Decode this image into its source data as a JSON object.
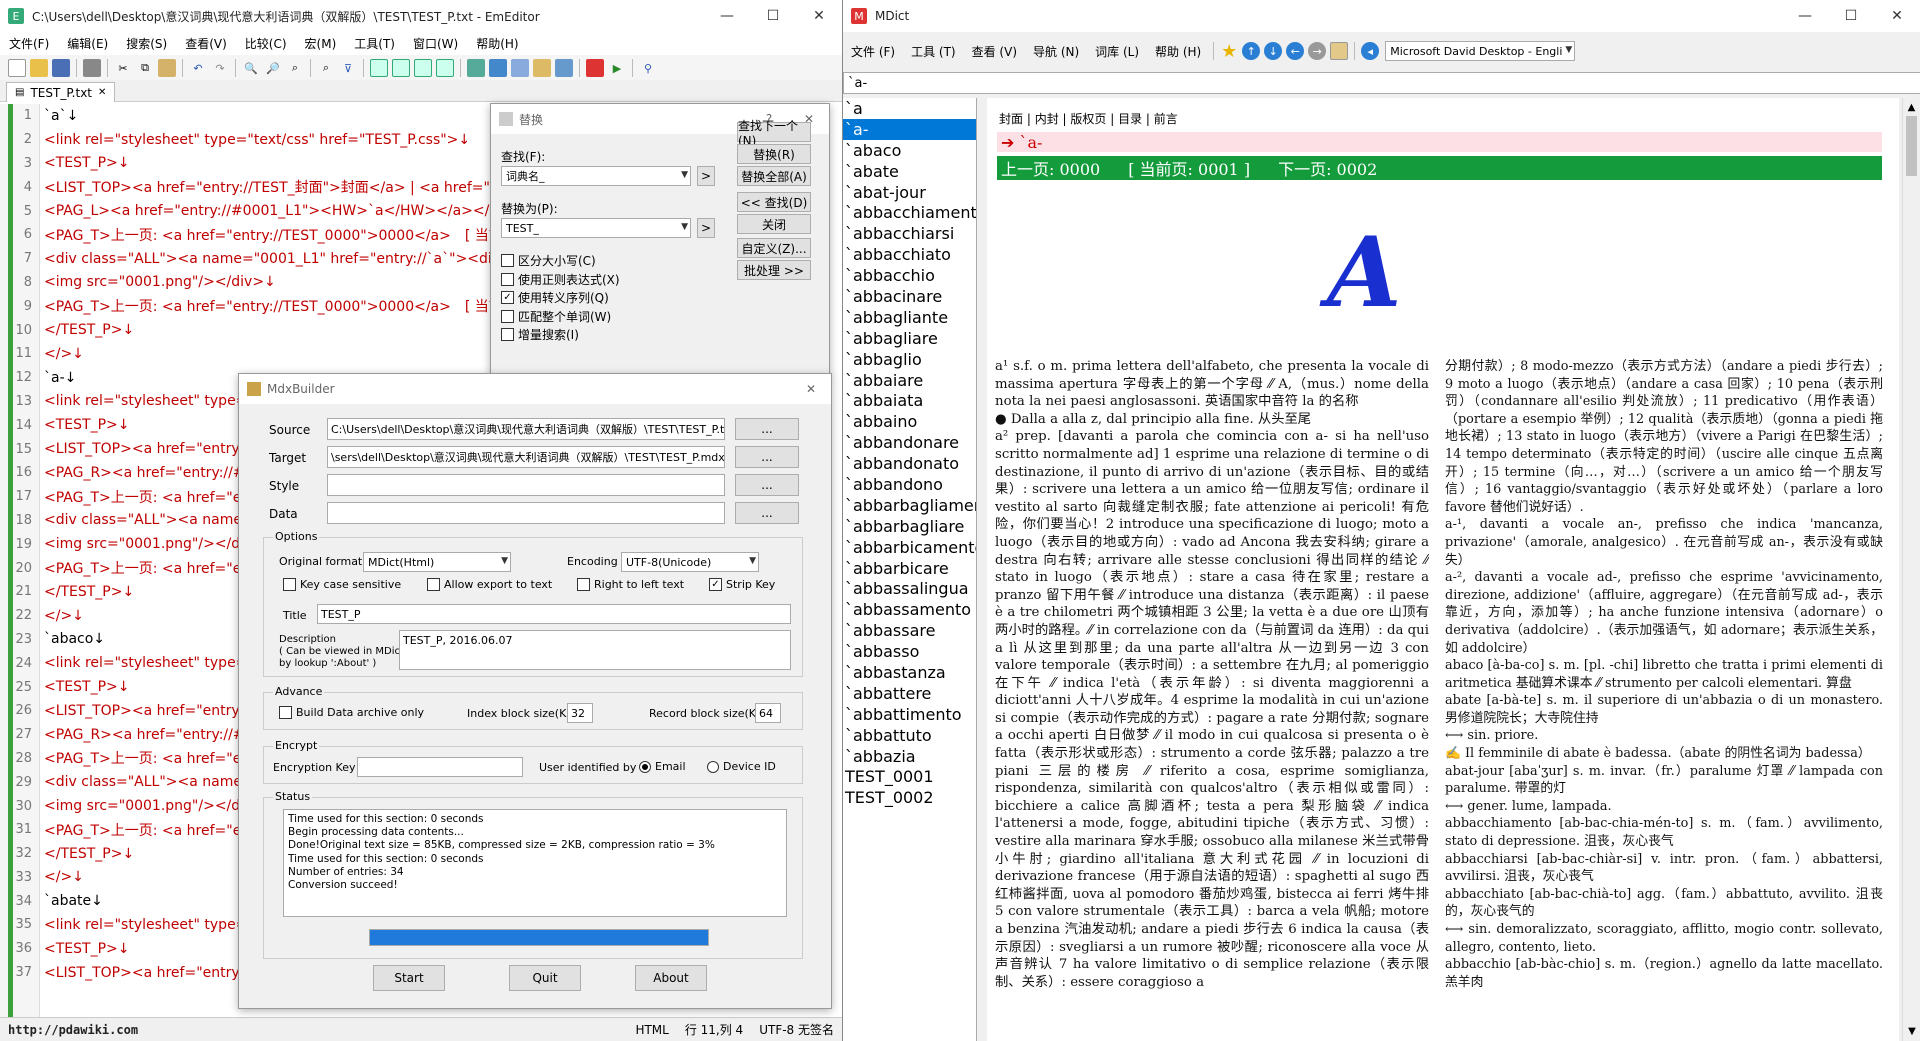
{
  "emeditor": {
    "title": "C:\\Users\\dell\\Desktop\\意汉词典\\现代意大利语词典（双解版）\\TEST\\TEST_P.txt - EmEditor",
    "menu": [
      "文件(F)",
      "编辑(E)",
      "搜索(S)",
      "查看(V)",
      "比较(C)",
      "宏(M)",
      "工具(T)",
      "窗口(W)",
      "帮助(H)"
    ],
    "tab": "TEST_P.txt",
    "lines": [
      "`a`↓",
      "<link rel=\"stylesheet\" type=\"text/css\" href=\"TEST_P.css\">↓",
      "<TEST_P>↓",
      "<LIST_TOP><a href=\"entry://TEST_封面\">封面</a> | <a href=\"entry",
      "<PAG_L><a href=\"entry://#0001_L1\"><HW>`a</HW></a></PAG_",
      "<PAG_T>上一页: <a href=\"entry://TEST_0000\">0000</a>　[ 当前页",
      "<div class=\"ALL\"><a name=\"0001_L1\" href=\"entry://`a`\"><div class",
      "<img src=\"0001.png\"/></div>↓",
      "<PAG_T>上一页: <a href=\"entry://TEST_0000\">0000</a>　[ 当前页",
      "</TEST_P>↓",
      "</>↓",
      "`a-↓",
      "<link rel=\"stylesheet\" type=\"t",
      "<TEST_P>↓",
      "<LIST_TOP><a href=\"entry://",
      "<PAG_R><a href=\"entry://#0",
      "<PAG_T>上一页: <a href=\"ent",
      "<div class=\"ALL\"><a name=\"",
      "<img src=\"0001.png\"/></div",
      "<PAG_T>上一页: <a href=\"ent",
      "</TEST_P>↓",
      "</>↓",
      "`abaco↓",
      "<link rel=\"stylesheet\" type=\"t",
      "<TEST_P>↓",
      "<LIST_TOP><a href=\"entry://",
      "<PAG_R><a href=\"entry://#0",
      "<PAG_T>上一页: <a href=\"ent",
      "<div class=\"ALL\"><a name=\"",
      "<img src=\"0001.png\"/></div",
      "<PAG_T>上一页: <a href=\"ent",
      "</TEST_P>↓",
      "</>↓",
      "`abate↓",
      "<link rel=\"stylesheet\" type=\"t",
      "<TEST_P>↓",
      "<LIST_TOP><a href=\"entry://"
    ],
    "status": {
      "watermark": "http://pdawiki.com",
      "mode": "HTML",
      "pos": "行 11,列 4",
      "enc": "UTF-8 无签名"
    }
  },
  "replace": {
    "title": "替换",
    "find_label": "查找(F):",
    "find_value": "词典名_",
    "replace_label": "替换为(P):",
    "replace_value": "TEST_",
    "checks": [
      {
        "label": "区分大小写(C)",
        "checked": false
      },
      {
        "label": "使用正则表达式(X)",
        "checked": false
      },
      {
        "label": "使用转义序列(Q)",
        "checked": true
      },
      {
        "label": "匹配整个单词(W)",
        "checked": false
      },
      {
        "label": "增量搜索(I)",
        "checked": false
      }
    ],
    "buttons": [
      "查找下一个(N)",
      "替换(R)",
      "替换全部(A)",
      "<< 查找(D)",
      "关闭",
      "自定义(Z)...",
      "批处理 >>"
    ]
  },
  "mdx": {
    "title": "MdxBuilder",
    "source_label": "Source",
    "source": "C:\\Users\\dell\\Desktop\\意汉词典\\现代意大利语词典（双解版）\\TEST\\TEST_P.t",
    "target_label": "Target",
    "target": "\\sers\\dell\\Desktop\\意汉词典\\现代意大利语词典（双解版）\\TEST\\TEST_P.mdx",
    "style_label": "Style",
    "data_label": "Data",
    "browse": "...",
    "options_title": "Options",
    "format_label": "Original format",
    "format": "MDict(Html)",
    "encoding_label": "Encoding",
    "encoding": "UTF-8(Unicode)",
    "key_case": "Key case sensitive",
    "allow_export": "Allow export to text",
    "rtl": "Right to left text",
    "strip_key": "Strip Key",
    "title_label": "Title",
    "title_value": "TEST_P",
    "desc_label": "Description",
    "desc_hint1": "( Can be viewed in MDict",
    "desc_hint2": "by lookup ':About' )",
    "desc_value": "TEST_P, 2016.06.07",
    "advance_title": "Advance",
    "build_data": "Build Data archive only",
    "index_label": "Index block size(K)",
    "index_value": "32",
    "record_label": "Record block size(K)",
    "record_value": "64",
    "encrypt_title": "Encrypt",
    "key_label": "Encryption Key",
    "user_label": "User identified by",
    "email": "Email",
    "device": "Device ID",
    "status_title": "Status",
    "log": [
      "Time used for this section: 0 seconds",
      "Begin processing data contents...",
      "Done!Original text size = 85KB, compressed size = 2KB, compression ratio = 3%",
      "Time used for this section: 0 seconds",
      "Number of entries: 34",
      "Conversion succeed!"
    ],
    "progress": 1.0,
    "start": "Start",
    "quit": "Quit",
    "about": "About"
  },
  "mdict": {
    "title": "MDict",
    "menu": [
      "文件 (F)",
      "工具 (T)",
      "查看 (V)",
      "导航 (N)",
      "词库 (L)",
      "帮助 (H)"
    ],
    "dict_select": "Microsoft David Desktop - Engli",
    "address": "`a-",
    "words": [
      "`a",
      "`a-",
      "`abaco",
      "`abate",
      "`abat-jour",
      "`abbacchiamento",
      "`abbacchiarsi",
      "`abbacchiato",
      "`abbacchio",
      "`abbacinare",
      "`abbagliante",
      "`abbagliare",
      "`abbaglio",
      "`abbaiare",
      "`abbaiata",
      "`abbaino",
      "`abbandonare",
      "`abbandonato",
      "`abbandono",
      "`abbarbagliamen",
      "`abbarbagliare",
      "`abbarbicamento",
      "`abbarbicare",
      "`abbassalingua",
      "`abbassamento",
      "`abbassare",
      "`abbasso",
      "`abbastanza",
      "`abbattere",
      "`abbattimento",
      "`abbattuto",
      "`abbazia",
      "TEST_0001",
      "TEST_0002"
    ],
    "selected_word": 1,
    "nav": [
      "封面",
      "内封",
      "版权页",
      "目录",
      "前言"
    ],
    "headword": "➔ `a-",
    "page_prev": "上一页: 0000",
    "page_cur": "[ 当前页: 0001 ]",
    "page_next": "下一页: 0002",
    "big_letter": "A",
    "col1": "a¹ s.f. o m. prima lettera dell'alfabeto, che presenta la vocale di massima apertura 字母表上的第一个字母 ⁄⁄ A,（mus.）nome della nota la nei paesi anglosassoni. 英语国家中音符 la 的名称\n● Dalla a alla z, dal principio alla fine. 从头至尾\na² prep. [davanti a parola che comincia con a- si ha nell'uso scritto normalmente ad] 1 esprime una relazione di termine o di destinazione, il punto di arrivo di un'azione（表示目标、目的或结果）: scrivere una lettera a un amico 给一位朋友写信; ordinare il vestito al sarto 向裁缝定制衣服; fate attenzione ai pericoli! 有危险，你们要当心！2 introduce una specificazione di luogo; moto a luogo（表示目的地或方向）: vado ad Ancona 我去安科纳; girare a destra 向右转; arrivare alle stesse conclusioni 得出同样的结论 ⁄⁄ stato in luogo（表示地点）: stare a casa 待在家里; restare a pranzo 留下用午餐 ⁄⁄ introduce una distanza（表示距离）: il paese è a tre chilometri 两个城镇相距 3 公里; la vetta è a due ore 山顶有两小时的路程。⁄⁄ in correlazione con da（与前置词 da 连用）: da qui a lì 从这里到那里; da una parte all'altra 从一边到另一边 3 con valore temporale（表示时间）: a settembre 在九月; al pomeriggio 在下午 ⁄⁄ indica l'età（表示年龄）: si diventa maggiorenni a diciott'anni 人十八岁成年。4 esprime la modalità in cui un'azione si compie（表示动作完成的方式）: pagare a rate 分期付款; sognare a occhi aperti 白日做梦 ⁄⁄ il modo in cui qualcosa si presenta o è fatta（表示形状或形态）: strumento a corde 弦乐器; palazzo a tre piani 三层的楼房 ⁄⁄ riferito a cosa, esprime somiglianza, rispondenza, similarità con qualcos'altro（表示相似或雷同）: bicchiere a calice 高脚酒杯; testa a pera 梨形脑袋 ⁄⁄ indica l'attenersi a mode, fogge, abitudini tipiche（表示方式、习惯）: vestire alla marinara 穿水手服; ossobuco alla milanese 米兰式带骨小牛肘; giardino all'italiana 意大利式花园 ⁄⁄ in locuzioni di derivazione francese（用于源自法语的短语）: spaghetti al sugo 西红柿酱拌面, uova al pomodoro 番茄炒鸡蛋, bistecca ai ferri 烤牛排 5 con valore strumentale（表示工具）: barca a vela 帆船; motore a benzina 汽油发动机; andare a piedi 步行去 6 indica la causa（表示原因）: svegliarsi a un rumore 被吵醒; riconoscere alla voce 从声音辨认 7 ha valore limitativo o di semplice relazione（表示限制、关系）: essere coraggioso a",
    "col2": "分期付款）; 8 modo-mezzo（表示方式方法）（andare a piedi 步行去）; 9 moto a luogo（表示地点）（andare a casa 回家）; 10 pena（表示刑罚）（condannare all'esilio 判处流放）; 11 predicativo（用作表语）（portare a esempio 举例）; 12 qualità（表示质地）（gonna a piedi 拖地长裙）; 13 stato in luogo（表示地方）（vivere a Parigi 在巴黎生活）; 14 tempo determinato（表示特定的时间）（uscire alle cinque 五点离开）; 15 termine（向…，对…）（scrivere a un amico 给一个朋友写信）; 16 vantaggio/svantaggio（表示好处或坏处）（parlare a loro favore 替他们说好话）.\na-¹, davanti a vocale an-, prefisso che indica 'mancanza, privazione'（amorale, analgesico）. 在元音前写成 an-，表示没有或缺失）\na-², davanti a vocale ad-, prefisso che esprime 'avvicinamento, direzione, addizione'（affluire, aggregare）（在元音前写成 ad-，表示靠近，方向，添加等）; ha anche funzione intensiva（adornare）o derivativa（addolcire）.（表示加强语气，如 adornare；表示派生关系，如 addolcire）\nabaco [à-ba-co] s. m. [pl. -chi] libretto che tratta i primi elementi di aritmetica 基础算术课本 ⁄⁄ strumento per calcoli elementari. 算盘\nabate [a-bà-te] s. m. il superiore di un'abbazia o di un monastero. 男修道院院长；大寺院住持\n⟷ sin. priore.\n✍ Il femminile di abate è badessa.（abate 的阴性名词为 badessa）\nabat-jour [abaˈʒur] s. m. invar.（fr.）paralume 灯罩 ⁄⁄ lampada con paralume. 带罩的灯\n⟷ gener. lume, lampada.\nabbacchiamento [ab-bac-chia-mén-to] s. m.（fam.）avvilimento, stato di depressione. 沮丧，灰心丧气\nabbacchiarsi [ab-bac-chiàr-si] v. intr. pron.（fam.）abbattersi, avvilirsi. 沮丧，灰心丧气\nabbacchiato [ab-bac-chià-to] agg.（fam.）abbattuto, avvilito. 沮丧的，灰心丧气的\n⟷ sin. demoralizzato, scoraggiato, afflitto, mogio contr. sollevato, allegro, contento, lieto.\nabbacchio [ab-bàc-chio] s. m.（region.）agnello da latte macellato. 羔羊肉"
  }
}
